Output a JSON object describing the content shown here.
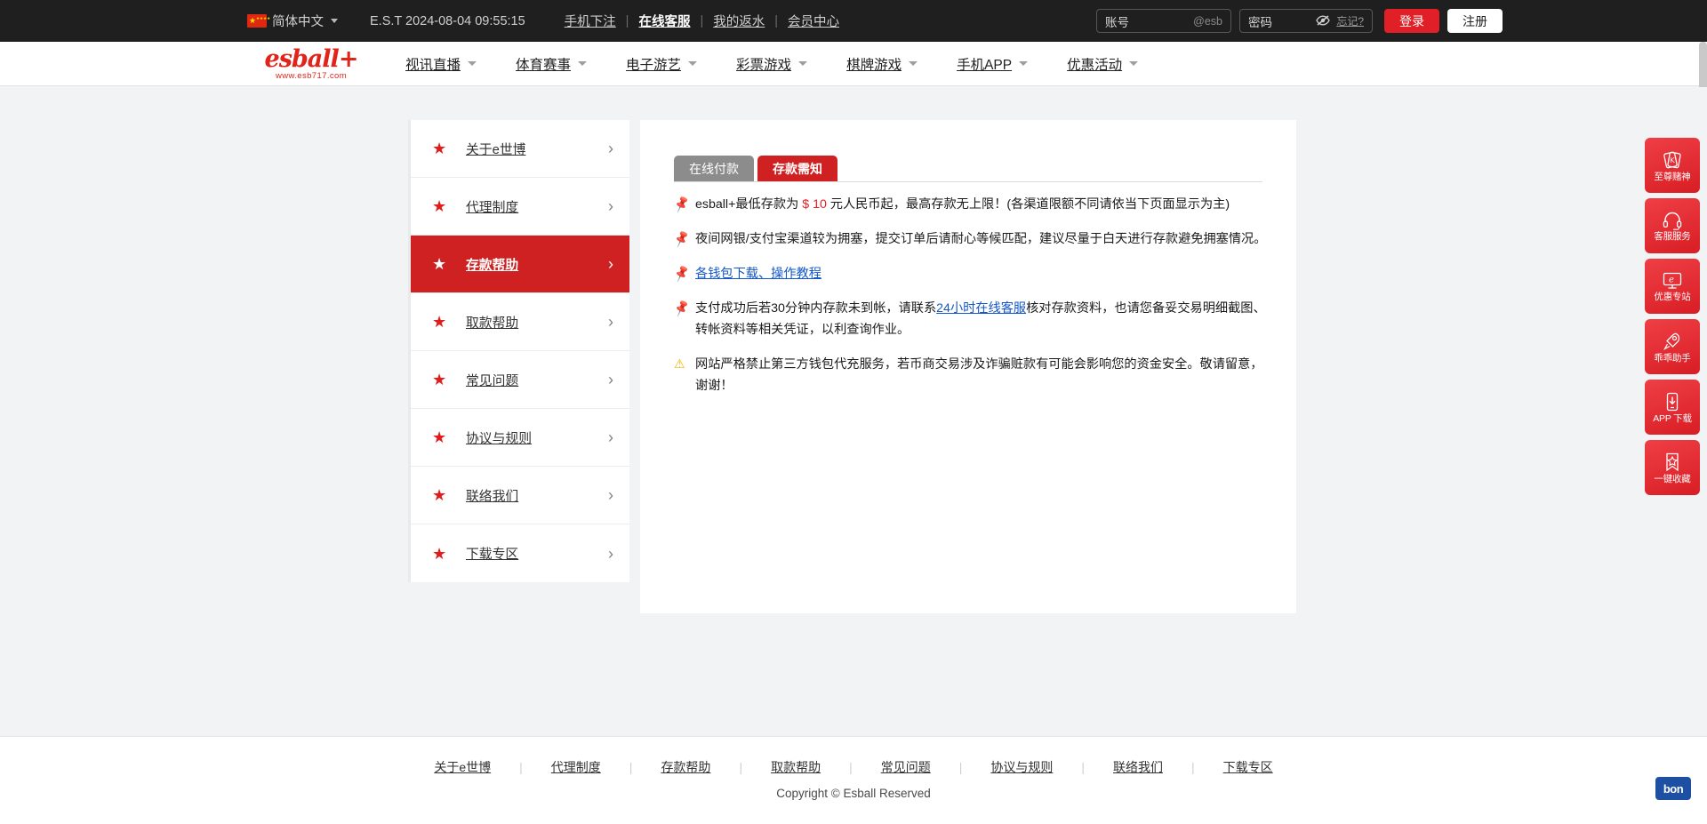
{
  "topbar": {
    "language": "简体中文",
    "clock": "E.S.T 2024-08-04 09:55:15",
    "links": [
      {
        "label": "手机下注",
        "strong": false
      },
      {
        "label": "在线客服",
        "strong": true
      },
      {
        "label": "我的返水",
        "strong": false
      },
      {
        "label": "会员中心",
        "strong": false
      }
    ],
    "separator": "|",
    "account_label": "账号",
    "account_placeholder": "@esb",
    "password_label": "密码",
    "forgot_label": "忘记?",
    "login_label": "登录",
    "register_label": "注册"
  },
  "nav": {
    "logo_text": "esball+",
    "logo_url": "www.esb717.com",
    "items": [
      {
        "label": "视讯直播"
      },
      {
        "label": "体育赛事"
      },
      {
        "label": "电子游艺"
      },
      {
        "label": "彩票游戏"
      },
      {
        "label": "棋牌游戏"
      },
      {
        "label": "手机APP"
      },
      {
        "label": "优惠活动"
      }
    ]
  },
  "sidebar": {
    "items": [
      {
        "label": "关于e世博",
        "active": false
      },
      {
        "label": "代理制度",
        "active": false
      },
      {
        "label": "存款帮助",
        "active": true
      },
      {
        "label": "取款帮助",
        "active": false
      },
      {
        "label": "常见问题",
        "active": false
      },
      {
        "label": "协议与规则",
        "active": false
      },
      {
        "label": "联络我们",
        "active": false
      },
      {
        "label": "下载专区",
        "active": false
      }
    ],
    "star_glyph": "★",
    "arrow_glyph": "›"
  },
  "main": {
    "tabs": [
      {
        "label": "在线付款",
        "active": false
      },
      {
        "label": "存款需知",
        "active": true
      }
    ],
    "notices": [
      {
        "icon": "pushpin",
        "parts": [
          {
            "t": "esball+最低存款为 ",
            "style": "normal"
          },
          {
            "t": "$ 10",
            "style": "amount"
          },
          {
            "t": " 元人民币起，最高存款无上限！(各渠道限额不同请依当下页面显示为主)",
            "style": "normal"
          }
        ]
      },
      {
        "icon": "pushpin",
        "parts": [
          {
            "t": "夜间网银/支付宝渠道较为拥塞，提交订单后请耐心等候匹配，建议尽量于白天进行存款避免拥塞情况。",
            "style": "normal"
          }
        ]
      },
      {
        "icon": "pushpin",
        "parts": [
          {
            "t": "各钱包下载、操作教程",
            "style": "link"
          }
        ]
      },
      {
        "icon": "pushpin",
        "parts": [
          {
            "t": "支付成功后若30分钟内存款未到帐，请联系",
            "style": "normal"
          },
          {
            "t": "24小时在线客服",
            "style": "link"
          },
          {
            "t": "核对存款资料，也请您备妥交易明细截图、转帐资料等相关凭证，以利查询作业。",
            "style": "normal"
          }
        ]
      },
      {
        "icon": "warning",
        "parts": [
          {
            "t": "网站严格禁止第三方钱包代充服务，若币商交易涉及诈骗赃款有可能会影响您的资金安全。敬请留意，谢谢！",
            "style": "normal"
          }
        ]
      }
    ]
  },
  "dock": {
    "items": [
      {
        "caption": "至尊赌神",
        "icon": "poker-cards-icon"
      },
      {
        "caption": "客服服务",
        "icon": "headset-icon"
      },
      {
        "caption": "优惠专站",
        "icon": "monitor-e-icon"
      },
      {
        "caption": "乖乖助手",
        "icon": "rocket-icon"
      },
      {
        "caption": "APP 下载",
        "icon": "phone-download-icon"
      },
      {
        "caption": "一键收藏",
        "icon": "bookmark-star-icon"
      }
    ]
  },
  "footer": {
    "links": [
      {
        "label": "关于e世博"
      },
      {
        "label": "代理制度"
      },
      {
        "label": "存款帮助"
      },
      {
        "label": "取款帮助"
      },
      {
        "label": "常见问题"
      },
      {
        "label": "协议与规则"
      },
      {
        "label": "联络我们"
      },
      {
        "label": "下载专区"
      }
    ],
    "separator": "|",
    "copyright": "Copyright © Esball Reserved",
    "brand_badge": "bon"
  }
}
